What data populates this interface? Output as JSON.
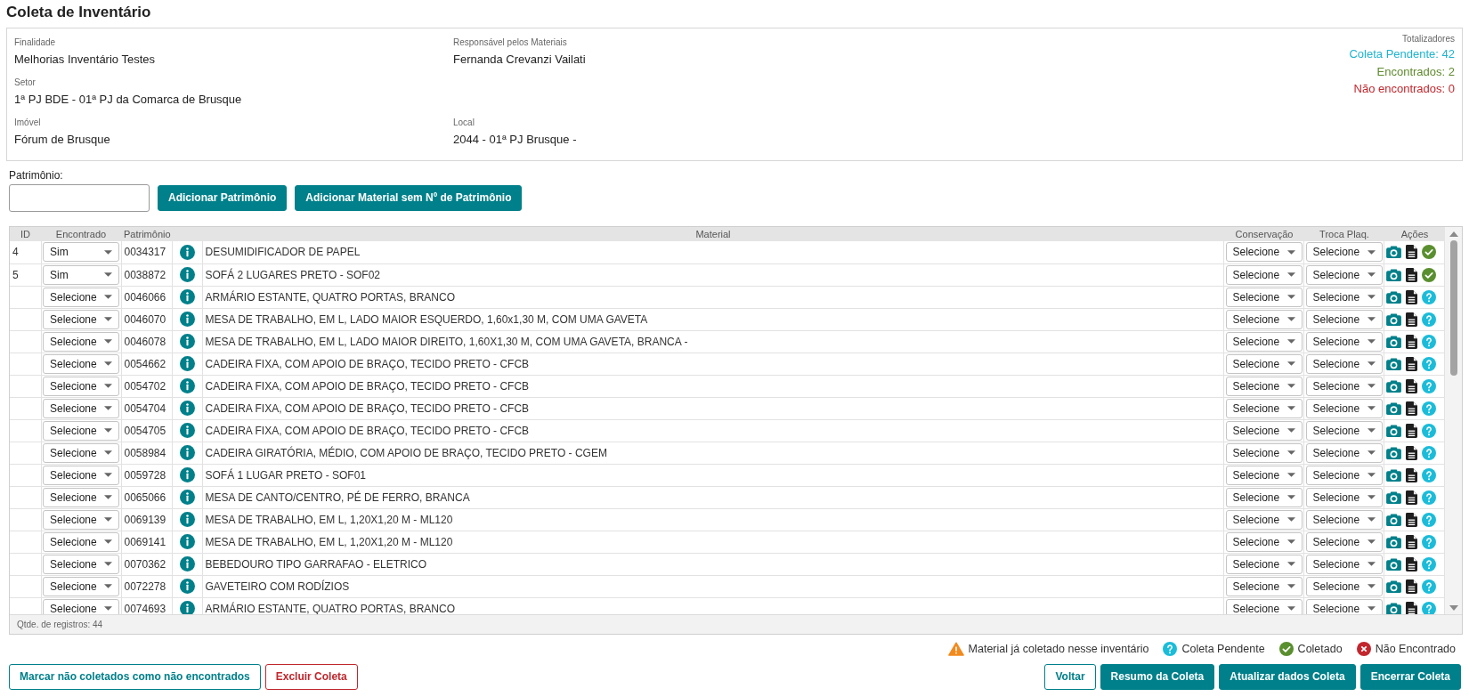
{
  "page": {
    "title": "Coleta de Inventário"
  },
  "info": {
    "rows": [
      [
        {
          "label": "Finalidade",
          "value": "Melhorias Inventário Testes"
        },
        {
          "label": "Responsável pelos Materiais",
          "value": "Fernanda Crevanzi Vailati"
        }
      ],
      [
        {
          "label": "Setor",
          "value": "1ª PJ BDE - 01ª PJ da Comarca de Brusque"
        }
      ],
      [
        {
          "label": "Imóvel",
          "value": "Fórum de Brusque"
        },
        {
          "label": "Local",
          "value": "2044 - 01ª PJ Brusque -"
        }
      ]
    ],
    "totals": {
      "label": "Totalizadores",
      "items": [
        {
          "text": "Coleta Pendente: 42",
          "color": "#1fb3cf"
        },
        {
          "text": "Encontrados: 2",
          "color": "#5f8a2e"
        },
        {
          "text": "Não encontrados: 0",
          "color": "#c0272d"
        }
      ]
    }
  },
  "asset_entry": {
    "label": "Patrimônio:",
    "buttons": [
      "Adicionar Patrimônio",
      "Adicionar Material sem Nº de Patrimônio"
    ]
  },
  "table": {
    "columns": [
      "ID",
      "Encontrado",
      "Patrimônio",
      "Material",
      "Conservação",
      "Troca Plaq.",
      "Ações"
    ],
    "rows": [
      {
        "id": "4",
        "found": "Sim",
        "asset": "0034317",
        "material": "DESUMIDIFICADOR DE PAPEL",
        "conservation": "Selecione",
        "plate_change": "Selecione",
        "collected": true
      },
      {
        "id": "5",
        "found": "Sim",
        "asset": "0038872",
        "material": "SOFÁ 2 LUGARES PRETO - SOF02",
        "conservation": "Selecione",
        "plate_change": "Selecione",
        "collected": true
      },
      {
        "found": "Selecione",
        "asset": "0046066",
        "material": "ARMÁRIO ESTANTE, QUATRO PORTAS, BRANCO",
        "conservation": "Selecione",
        "plate_change": "Selecione",
        "collected": false
      },
      {
        "found": "Selecione",
        "asset": "0046070",
        "material": "MESA DE TRABALHO, EM L, LADO MAIOR ESQUERDO, 1,60x1,30 M, COM UMA GAVETA",
        "conservation": "Selecione",
        "plate_change": "Selecione",
        "collected": false
      },
      {
        "found": "Selecione",
        "asset": "0046078",
        "material": "MESA DE TRABALHO, EM L, LADO MAIOR DIREITO, 1,60X1,30 M, COM UMA GAVETA, BRANCA -",
        "conservation": "Selecione",
        "plate_change": "Selecione",
        "collected": false
      },
      {
        "found": "Selecione",
        "asset": "0054662",
        "material": "CADEIRA FIXA, COM APOIO DE BRAÇO, TECIDO PRETO - CFCB",
        "conservation": "Selecione",
        "plate_change": "Selecione",
        "collected": false
      },
      {
        "found": "Selecione",
        "asset": "0054702",
        "material": "CADEIRA FIXA, COM APOIO DE BRAÇO, TECIDO PRETO - CFCB",
        "conservation": "Selecione",
        "plate_change": "Selecione",
        "collected": false
      },
      {
        "found": "Selecione",
        "asset": "0054704",
        "material": "CADEIRA FIXA, COM APOIO DE BRAÇO, TECIDO PRETO - CFCB",
        "conservation": "Selecione",
        "plate_change": "Selecione",
        "collected": false
      },
      {
        "found": "Selecione",
        "asset": "0054705",
        "material": "CADEIRA FIXA, COM APOIO DE BRAÇO, TECIDO PRETO - CFCB",
        "conservation": "Selecione",
        "plate_change": "Selecione",
        "collected": false
      },
      {
        "found": "Selecione",
        "asset": "0058984",
        "material": "CADEIRA GIRATÓRIA, MÉDIO, COM APOIO DE BRAÇO, TECIDO PRETO - CGEM",
        "conservation": "Selecione",
        "plate_change": "Selecione",
        "collected": false
      },
      {
        "found": "Selecione",
        "asset": "0059728",
        "material": "SOFÁ 1 LUGAR PRETO - SOF01",
        "conservation": "Selecione",
        "plate_change": "Selecione",
        "collected": false
      },
      {
        "found": "Selecione",
        "asset": "0065066",
        "material": "MESA DE CANTO/CENTRO, PÉ DE FERRO, BRANCA",
        "conservation": "Selecione",
        "plate_change": "Selecione",
        "collected": false
      },
      {
        "found": "Selecione",
        "asset": "0069139",
        "material": "MESA DE TRABALHO, EM L, 1,20X1,20 M - ML120",
        "conservation": "Selecione",
        "plate_change": "Selecione",
        "collected": false
      },
      {
        "found": "Selecione",
        "asset": "0069141",
        "material": "MESA DE TRABALHO, EM L, 1,20X1,20 M - ML120",
        "conservation": "Selecione",
        "plate_change": "Selecione",
        "collected": false
      },
      {
        "found": "Selecione",
        "asset": "0070362",
        "material": "BEBEDOURO TIPO GARRAFAO - ELETRICO",
        "conservation": "Selecione",
        "plate_change": "Selecione",
        "collected": false
      },
      {
        "found": "Selecione",
        "asset": "0072278",
        "material": "GAVETEIRO COM RODÍZIOS",
        "conservation": "Selecione",
        "plate_change": "Selecione",
        "collected": false
      },
      {
        "found": "Selecione",
        "asset": "0074693",
        "material": "ARMÁRIO ESTANTE, QUATRO PORTAS, BRANCO",
        "conservation": "Selecione",
        "plate_change": "Selecione",
        "collected": false
      }
    ],
    "footer": "Qtde. de registros: 44"
  },
  "legend": [
    {
      "kind": "warning",
      "label": "Material já coletado nesse inventário"
    },
    {
      "kind": "pending",
      "label": "Coleta Pendente"
    },
    {
      "kind": "collected",
      "label": "Coletado"
    },
    {
      "kind": "not_found",
      "label": "Não Encontrado"
    }
  ],
  "actions": {
    "left": [
      {
        "label": "Marcar não coletados como não encontrados",
        "kind": "outline"
      },
      {
        "label": "Excluir Coleta",
        "kind": "danger"
      }
    ],
    "right": [
      {
        "label": "Voltar",
        "kind": "outline"
      },
      {
        "label": "Resumo da Coleta",
        "kind": "primary"
      },
      {
        "label": "Atualizar dados Coleta",
        "kind": "primary"
      },
      {
        "label": "Encerrar Coleta",
        "kind": "primary"
      }
    ]
  }
}
